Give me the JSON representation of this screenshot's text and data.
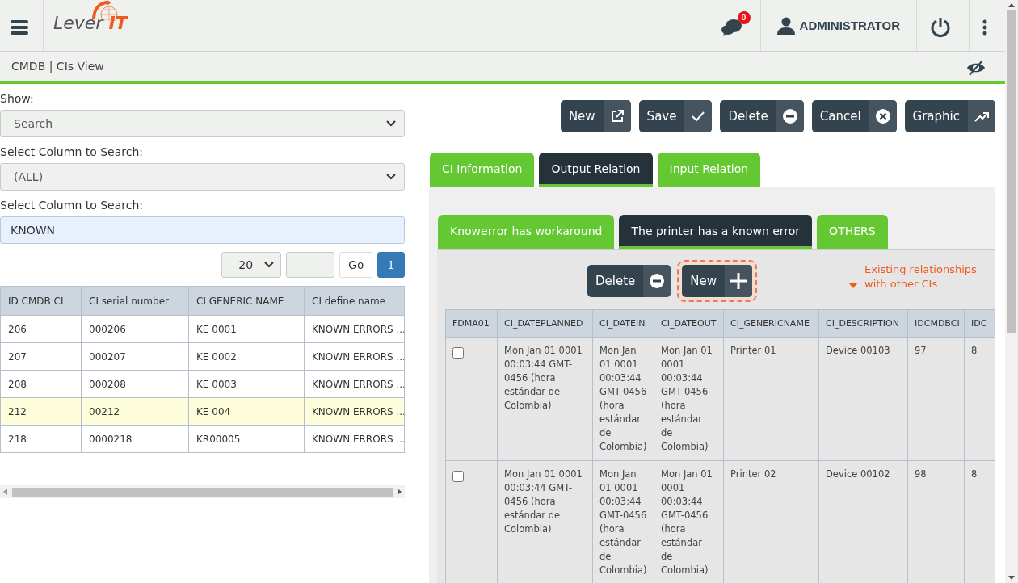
{
  "header": {
    "logo": {
      "part1": "Lever",
      "part2": "IT"
    },
    "notifications": "0",
    "user": "ADMINISTRATOR"
  },
  "breadcrumb": "CMDB | CIs View",
  "filters": [
    {
      "label": "Show:",
      "kind": "select",
      "value": "Search"
    },
    {
      "label": "Select Column to Search:",
      "kind": "select",
      "value": "(ALL)"
    },
    {
      "label": "Select Column to Search:",
      "kind": "input",
      "value": "KNOWN"
    }
  ],
  "pager": {
    "page_size": "20",
    "go": "Go",
    "pages": [
      {
        "label": "1",
        "selected": true
      }
    ]
  },
  "ci_table": {
    "columns": [
      "ID CMDB CI",
      "CI serial number",
      "CI GENERIC NAME",
      "CI define name"
    ],
    "rows": [
      {
        "cells": [
          "206",
          "000206",
          "KE 0001",
          "KNOWN ERRORS ..."
        ],
        "selected": false
      },
      {
        "cells": [
          "207",
          "000207",
          "KE 0002",
          "KNOWN ERRORS ..."
        ],
        "selected": false
      },
      {
        "cells": [
          "208",
          "000208",
          "KE 0003",
          "KNOWN ERRORS ..."
        ],
        "selected": false
      },
      {
        "cells": [
          "212",
          "00212",
          "KE 004",
          "KNOWN ERRORS ..."
        ],
        "selected": true
      },
      {
        "cells": [
          "218",
          "0000218",
          "KR00005",
          "KNOWN ERRORS ..."
        ],
        "selected": false
      }
    ]
  },
  "toolbar": [
    {
      "label": "New",
      "kind": "open"
    },
    {
      "label": "Save",
      "kind": "save"
    },
    {
      "label": "Delete",
      "kind": "delete"
    },
    {
      "label": "Cancel",
      "kind": "cancel"
    },
    {
      "label": "Graphic",
      "kind": "graph"
    }
  ],
  "tabs": [
    {
      "label": "CI Information",
      "selected": false
    },
    {
      "label": "Output Relation",
      "selected": true
    },
    {
      "label": "Input Relation",
      "selected": false
    }
  ],
  "sub_tabs": [
    {
      "label": "Knowerror has workaround",
      "selected": false
    },
    {
      "label": "The printer has a known error",
      "selected": true
    },
    {
      "label": "OTHERS",
      "selected": false
    }
  ],
  "sub_toolbar": [
    {
      "label": "Delete",
      "kind": "delete",
      "highlighted": false
    },
    {
      "label": "New",
      "kind": "add",
      "highlighted": true
    }
  ],
  "annotation": "Existing relationships with other CIs",
  "relation_table": {
    "columns": [
      "FDMA01",
      "CI_DATEPLANNED",
      "CI_DATEIN",
      "CI_DATEOUT",
      "CI_GENERICNAME",
      "CI_DESCRIPTION",
      "IDCMDBCI",
      "IDC"
    ],
    "rows": [
      {
        "checked": false,
        "cells": [
          "",
          "Mon Jan 01 0001 00:03:44 GMT-0456 (hora estándar de Colombia)",
          "Mon Jan 01 0001 00:03:44 GMT-0456 (hora estándar de Colombia)",
          "Mon Jan 01 0001 00:03:44 GMT-0456 (hora estándar de Colombia)",
          "Printer 01",
          "Device 00103",
          "97",
          "8"
        ]
      },
      {
        "checked": false,
        "cells": [
          "",
          "Mon Jan 01 0001 00:03:44 GMT-0456 (hora estándar de Colombia)",
          "Mon Jan 01 0001 00:03:44 GMT-0456 (hora estándar de Colombia)",
          "Mon Jan 01 0001 00:03:44 GMT-0456 (hora estándar de Colombia)",
          "Printer 02",
          "Device 00102",
          "98",
          "8"
        ]
      }
    ]
  }
}
